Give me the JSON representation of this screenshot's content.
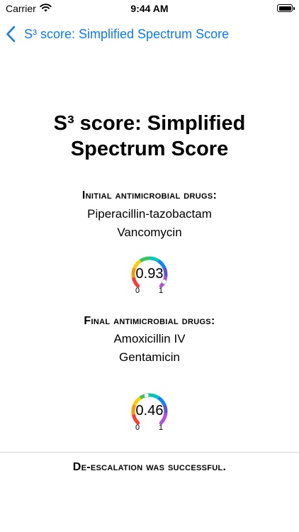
{
  "status_bar": {
    "carrier": "Carrier",
    "time": "9:44 AM",
    "icons": [
      "wifi-icon",
      "battery-icon"
    ]
  },
  "nav": {
    "back_label": "S³ score: Simplified Spectrum Score",
    "back_icon": "chevron-left-icon",
    "tint_color": "#0a7aff"
  },
  "title": {
    "line1": "S³ score: Simplified",
    "line2": "Spectrum Score"
  },
  "initial": {
    "heading": "Initial antimicrobial drugs:",
    "drugs": [
      "Piperacillin-tazobactam",
      "Vancomycin"
    ],
    "gauge": {
      "value": 0.93,
      "display": "0.93",
      "min_label": "0",
      "max_label": "1"
    }
  },
  "final": {
    "heading": "Final antimicrobial drugs:",
    "drugs": [
      "Amoxicillin IV",
      "Gentamicin"
    ],
    "gauge": {
      "value": 0.46,
      "display": "0.46",
      "min_label": "0",
      "max_label": "1"
    }
  },
  "result": {
    "text": "De-escalation was successful."
  },
  "gauge_colors": [
    "#ff3b30",
    "#ff9500",
    "#ffcc00",
    "#34c759",
    "#00c7be",
    "#0a84ff",
    "#5856d6",
    "#af52de"
  ]
}
